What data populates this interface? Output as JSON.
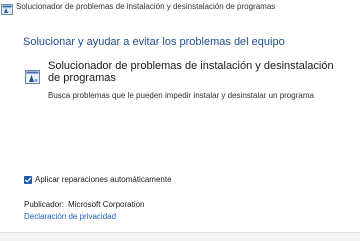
{
  "window": {
    "title": "Solucionador de problemas de instalación y desinstalación de programas",
    "icon": "troubleshooter-app-icon"
  },
  "main": {
    "heading": "Solucionar y ayudar a evitar los problemas del equipo",
    "option": {
      "title": "Solucionador de problemas de instalación y desinstalación de programas",
      "description": "Busca problemas que le pueden impedir instalar y desinstalar un programa",
      "icon": "program-install-icon"
    },
    "auto_repair": {
      "label": "Aplicar reparaciones automáticamente",
      "checked": true
    },
    "publisher": {
      "label": "Publicador:",
      "value": "Microsoft Corporation"
    },
    "privacy_link": "Declaración de privacidad"
  },
  "colors": {
    "accent": "#1f4e8c",
    "link": "#1f5fbf",
    "checkbox": "#1e5aa8"
  }
}
